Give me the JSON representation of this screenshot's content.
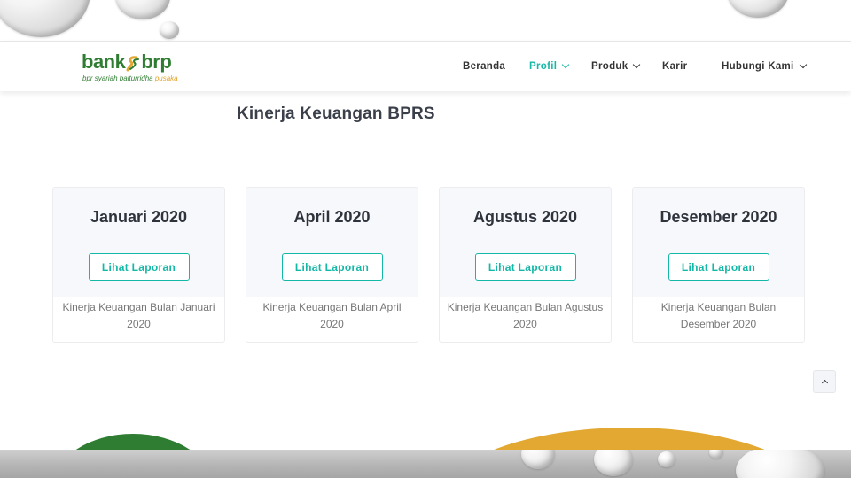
{
  "brand": {
    "name_left": "bank",
    "name_right": "brp",
    "tagline_main": "bpr syariah baiturridha ",
    "tagline_accent": "pusaka",
    "colors": {
      "green": "#2e7d32",
      "orange": "#e2a832",
      "accent": "#14b8a6"
    }
  },
  "nav": {
    "items": [
      {
        "label": "Beranda"
      },
      {
        "label": "Profil"
      },
      {
        "label": "Produk"
      },
      {
        "label": "Karir"
      },
      {
        "label": "Hubungi Kami"
      }
    ]
  },
  "page": {
    "title": "Kinerja Keuangan BPRS"
  },
  "cards": [
    {
      "heading": "Januari 2020",
      "button": "Lihat Laporan",
      "description": "Kinerja Keuangan Bulan Januari 2020"
    },
    {
      "heading": "April 2020",
      "button": "Lihat Laporan",
      "description": "Kinerja Keuangan Bulan April 2020"
    },
    {
      "heading": "Agustus 2020",
      "button": "Lihat Laporan",
      "description": "Kinerja Keuangan Bulan Agustus 2020"
    },
    {
      "heading": "Desember 2020",
      "button": "Lihat Laporan",
      "description": "Kinerja Keuangan Bulan Desember 2020"
    }
  ],
  "icons": {
    "scroll_top": "chevron-up-icon",
    "dropdown": "chevron-down-icon"
  }
}
